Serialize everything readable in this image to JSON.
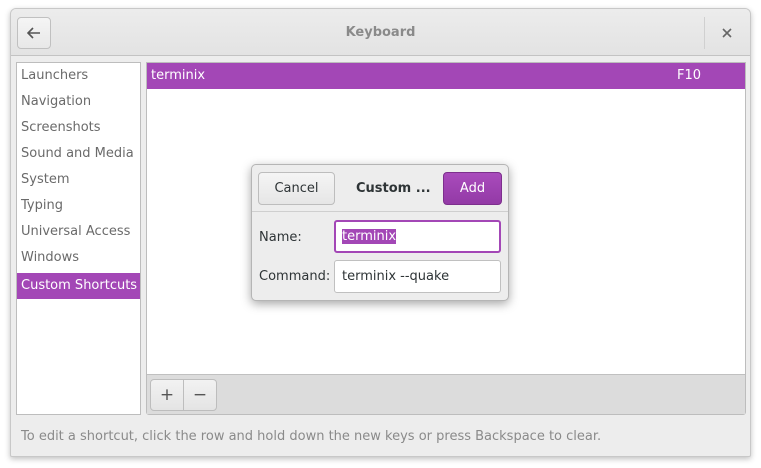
{
  "window": {
    "title": "Keyboard"
  },
  "header": {
    "back_icon": "back-arrow-icon",
    "close_icon": "close-icon",
    "close_glyph": "×"
  },
  "sidebar": {
    "items": [
      {
        "label": "Launchers"
      },
      {
        "label": "Navigation"
      },
      {
        "label": "Screenshots"
      },
      {
        "label": "Sound and Media"
      },
      {
        "label": "System"
      },
      {
        "label": "Typing"
      },
      {
        "label": "Universal Access"
      },
      {
        "label": "Windows"
      },
      {
        "label": "Custom Shortcuts",
        "selected": true
      }
    ]
  },
  "shortcuts": [
    {
      "name": "terminix",
      "key": "F10"
    }
  ],
  "toolbar": {
    "add_glyph": "+",
    "remove_glyph": "−"
  },
  "hint": "To edit a shortcut, click the row and hold down the new keys or press Backspace to clear.",
  "dialog": {
    "cancel_label": "Cancel",
    "title": "Custom ...",
    "add_label": "Add",
    "name_label": "Name:",
    "name_value": "terminix",
    "command_label": "Command:",
    "command_value": "terminix --quake"
  },
  "colors": {
    "accent": "#a347b6"
  }
}
